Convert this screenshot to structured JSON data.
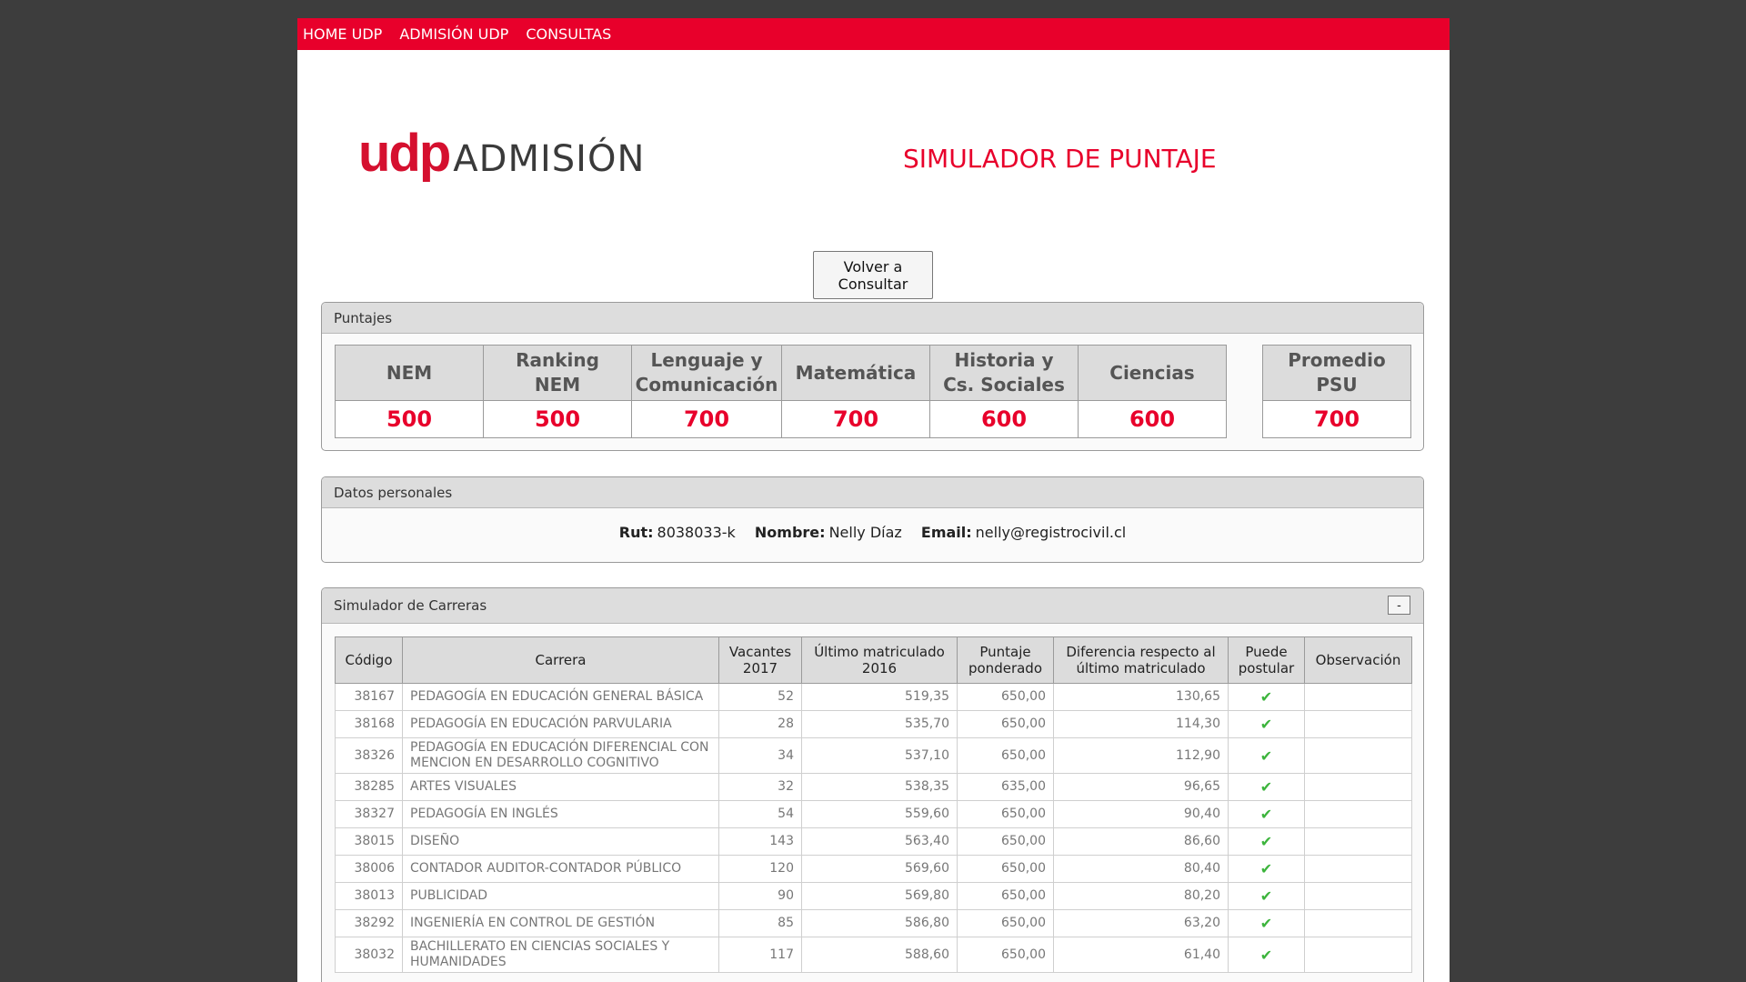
{
  "nav": [
    "HOME UDP",
    "ADMISIÓN UDP",
    "CONSULTAS"
  ],
  "logo": {
    "udp": "udp",
    "admision": "ADMISIÓN"
  },
  "title": "SIMULADOR DE PUNTAJE",
  "volver_button": [
    "Volver a",
    "Consultar"
  ],
  "puntajes": {
    "header": "Puntajes",
    "columns": [
      {
        "label": [
          "NEM"
        ],
        "value": "500"
      },
      {
        "label": [
          "Ranking",
          "NEM"
        ],
        "value": "500"
      },
      {
        "label": [
          "Lenguaje y",
          "Comunicación"
        ],
        "value": "700"
      },
      {
        "label": [
          "Matemática"
        ],
        "value": "700"
      },
      {
        "label": [
          "Historia y",
          "Cs. Sociales"
        ],
        "value": "600"
      },
      {
        "label": [
          "Ciencias"
        ],
        "value": "600"
      }
    ],
    "promedio": {
      "label": [
        "Promedio",
        "PSU"
      ],
      "value": "700"
    }
  },
  "personal": {
    "header": "Datos personales",
    "rut_label": "Rut:",
    "rut": "8038033-k",
    "nombre_label": "Nombre:",
    "nombre": "Nelly Díaz",
    "email_label": "Email:",
    "email": "nelly@registrocivil.cl"
  },
  "simulador": {
    "header": "Simulador de Carreras",
    "toggle": "-",
    "columns": [
      [
        "Código"
      ],
      [
        "Carrera"
      ],
      [
        "Vacantes",
        "2017"
      ],
      [
        "Último matriculado",
        "2016"
      ],
      [
        "Puntaje",
        "ponderado"
      ],
      [
        "Diferencia respecto al",
        "último matriculado"
      ],
      [
        "Puede",
        "postular"
      ],
      [
        "Observación"
      ]
    ],
    "rows": [
      {
        "codigo": "38167",
        "carrera": [
          "PEDAGOGÍA EN EDUCACIÓN GENERAL BÁSICA"
        ],
        "vacantes": "52",
        "ultimo": "519,35",
        "puntaje": "650,00",
        "diferencia": "130,65",
        "puede": true,
        "obs": ""
      },
      {
        "codigo": "38168",
        "carrera": [
          "PEDAGOGÍA EN EDUCACIÓN PARVULARIA"
        ],
        "vacantes": "28",
        "ultimo": "535,70",
        "puntaje": "650,00",
        "diferencia": "114,30",
        "puede": true,
        "obs": ""
      },
      {
        "codigo": "38326",
        "carrera": [
          "PEDAGOGÍA EN EDUCACIÓN DIFERENCIAL CON",
          "MENCION EN DESARROLLO COGNITIVO"
        ],
        "vacantes": "34",
        "ultimo": "537,10",
        "puntaje": "650,00",
        "diferencia": "112,90",
        "puede": true,
        "obs": ""
      },
      {
        "codigo": "38285",
        "carrera": [
          "ARTES VISUALES"
        ],
        "vacantes": "32",
        "ultimo": "538,35",
        "puntaje": "635,00",
        "diferencia": "96,65",
        "puede": true,
        "obs": ""
      },
      {
        "codigo": "38327",
        "carrera": [
          "PEDAGOGÍA EN INGLÉS"
        ],
        "vacantes": "54",
        "ultimo": "559,60",
        "puntaje": "650,00",
        "diferencia": "90,40",
        "puede": true,
        "obs": ""
      },
      {
        "codigo": "38015",
        "carrera": [
          "DISEÑO"
        ],
        "vacantes": "143",
        "ultimo": "563,40",
        "puntaje": "650,00",
        "diferencia": "86,60",
        "puede": true,
        "obs": ""
      },
      {
        "codigo": "38006",
        "carrera": [
          "CONTADOR AUDITOR-CONTADOR PÚBLICO"
        ],
        "vacantes": "120",
        "ultimo": "569,60",
        "puntaje": "650,00",
        "diferencia": "80,40",
        "puede": true,
        "obs": ""
      },
      {
        "codigo": "38013",
        "carrera": [
          "PUBLICIDAD"
        ],
        "vacantes": "90",
        "ultimo": "569,80",
        "puntaje": "650,00",
        "diferencia": "80,20",
        "puede": true,
        "obs": ""
      },
      {
        "codigo": "38292",
        "carrera": [
          "INGENIERÍA EN CONTROL DE GESTIÓN"
        ],
        "vacantes": "85",
        "ultimo": "586,80",
        "puntaje": "650,00",
        "diferencia": "63,20",
        "puede": true,
        "obs": ""
      },
      {
        "codigo": "38032",
        "carrera": [
          "BACHILLERATO EN CIENCIAS SOCIALES Y",
          "HUMANIDADES"
        ],
        "vacantes": "117",
        "ultimo": "588,60",
        "puntaje": "650,00",
        "diferencia": "61,40",
        "puede": true,
        "obs": ""
      }
    ]
  },
  "colors": {
    "brand_red": "#e8002b",
    "check_green": "#3cb43c"
  }
}
